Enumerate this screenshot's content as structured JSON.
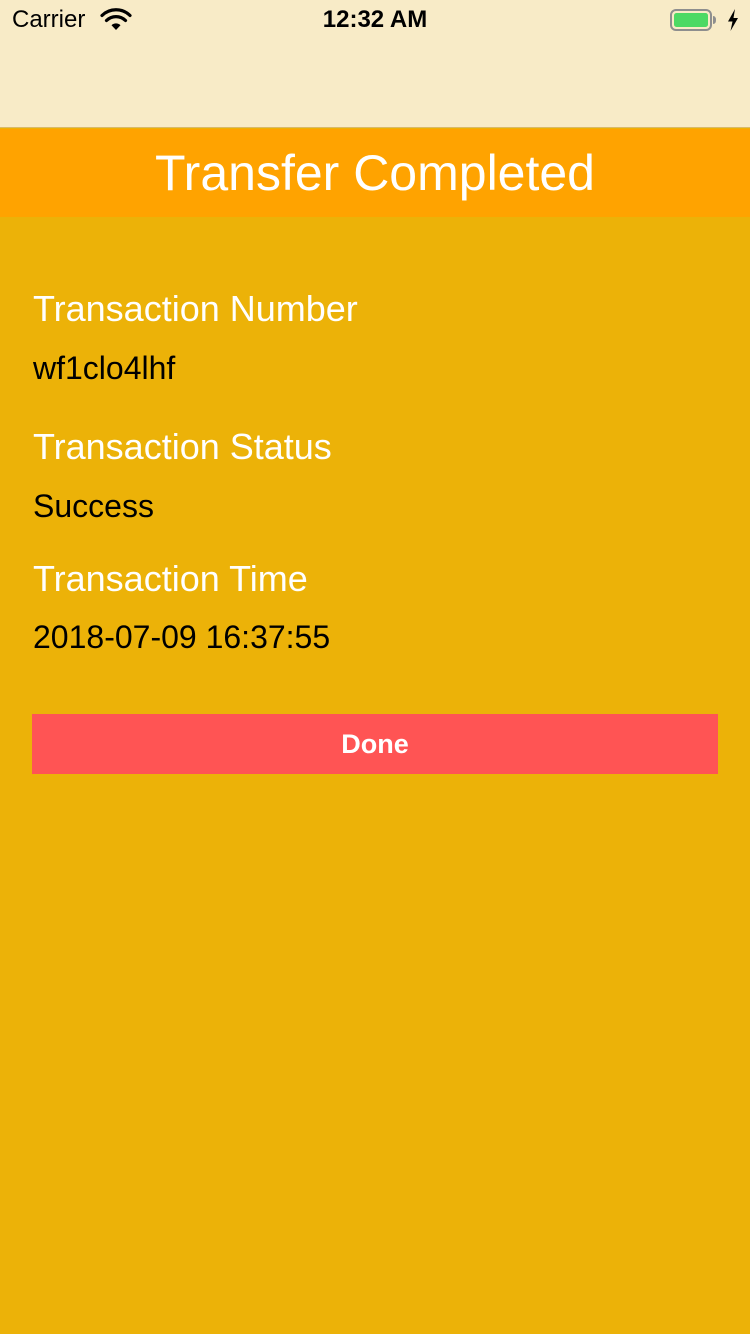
{
  "status_bar": {
    "carrier": "Carrier",
    "time": "12:32 AM",
    "icons": [
      "wifi-icon",
      "battery-icon",
      "charging-bolt-icon"
    ]
  },
  "header": {
    "title": "Transfer Completed"
  },
  "details": {
    "transaction_number_label": "Transaction Number",
    "transaction_number_value": "wf1clo4lhf",
    "transaction_status_label": "Transaction Status",
    "transaction_status_value": "Success",
    "transaction_time_label": "Transaction Time",
    "transaction_time_value": "2018-07-09 16:37:55"
  },
  "actions": {
    "done_label": "Done"
  },
  "colors": {
    "nav_background": "#F8EBC7",
    "header_background": "#FFA300",
    "page_background": "#ECB208",
    "button_background": "#FF5454",
    "battery_fill": "#4CD964"
  }
}
